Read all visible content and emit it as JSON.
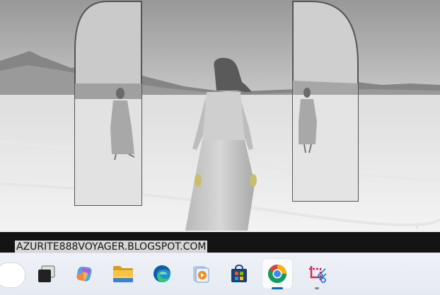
{
  "watermark": {
    "text": "AZURITE888VOYAGER.BLOGSPOT.COM"
  },
  "taskbar": {
    "apps": [
      {
        "id": "task-view",
        "icon": "task-view-icon"
      },
      {
        "id": "copilot",
        "icon": "copilot-icon"
      },
      {
        "id": "file-explorer",
        "icon": "folder-icon"
      },
      {
        "id": "edge",
        "icon": "edge-icon"
      },
      {
        "id": "media-player",
        "icon": "media-player-icon"
      },
      {
        "id": "store",
        "icon": "store-icon"
      },
      {
        "id": "chrome",
        "icon": "chrome-icon",
        "active": true
      },
      {
        "id": "snipping-tool",
        "icon": "snipping-tool-icon"
      }
    ]
  },
  "colors": {
    "accent": "#0067c0",
    "taskbar": "#e9edf4"
  }
}
